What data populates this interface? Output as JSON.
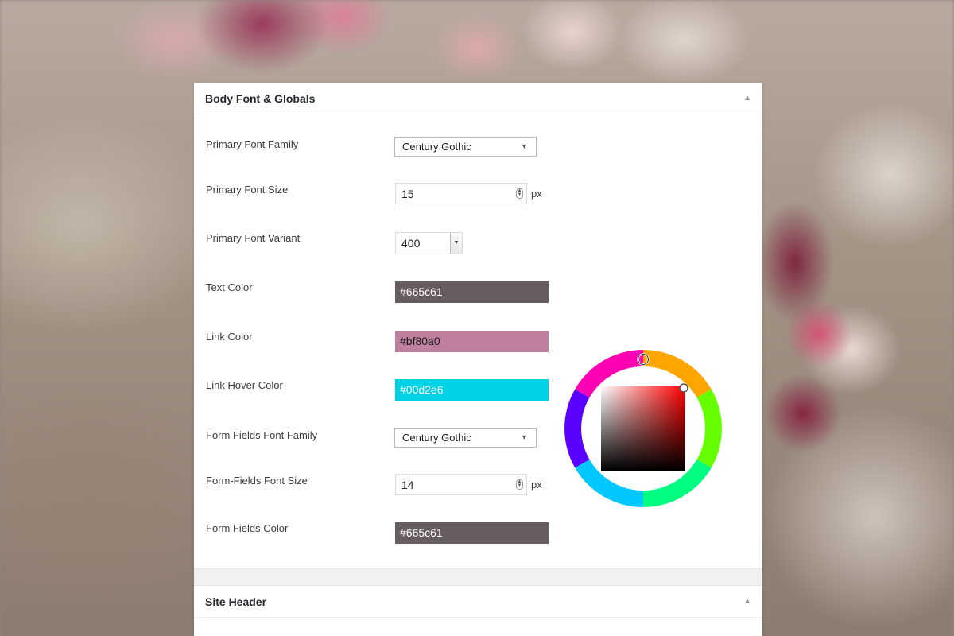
{
  "section1": {
    "title": "Body Font & Globals",
    "fields": {
      "primary_font_family": {
        "label": "Primary Font Family",
        "value": "Century Gothic"
      },
      "primary_font_size": {
        "label": "Primary Font Size",
        "value": "15",
        "unit": "px"
      },
      "primary_font_variant": {
        "label": "Primary Font Variant",
        "value": "400"
      },
      "text_color": {
        "label": "Text Color",
        "value": "#665c61",
        "color": "#665c61"
      },
      "link_color": {
        "label": "Link Color",
        "value": "#bf80a0",
        "color": "#bf80a0"
      },
      "link_hover_color": {
        "label": "Link Hover Color",
        "value": "#00d2e6",
        "color": "#00d2e6"
      },
      "form_fields_font_family": {
        "label": "Form Fields Font Family",
        "value": "Century Gothic"
      },
      "form_fields_font_size": {
        "label": "Form-Fields Font Size",
        "value": "14",
        "unit": "px"
      },
      "form_fields_color": {
        "label": "Form Fields Color",
        "value": "#665c61",
        "color": "#665c61"
      }
    }
  },
  "section2": {
    "title": "Site Header"
  },
  "icons": {
    "collapse": "triangle-up-icon",
    "dropdown": "chevron-down-icon",
    "spinner": "stepper-icon"
  }
}
